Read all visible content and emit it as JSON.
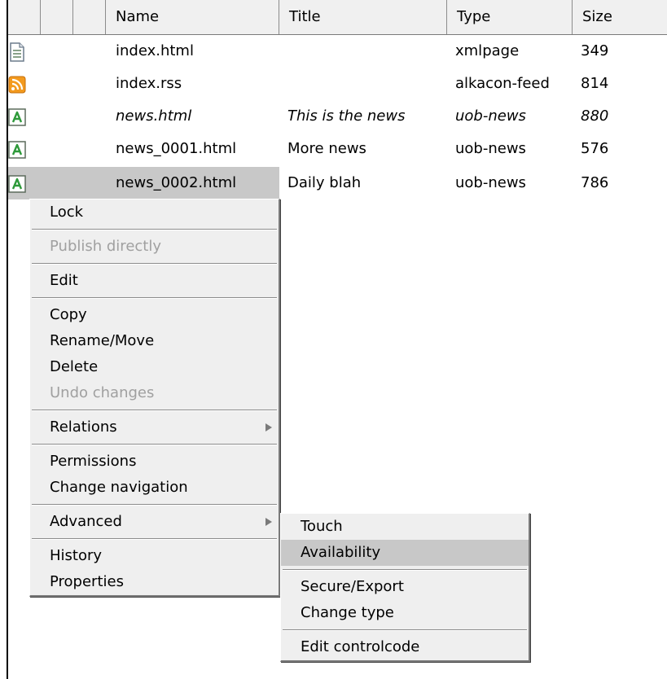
{
  "table": {
    "headers": [
      "Name",
      "Title",
      "Type",
      "Size"
    ],
    "rows": [
      {
        "icon": "xml-page-icon",
        "name": "index.html",
        "title": "",
        "type": "xmlpage",
        "size": "349",
        "italic": false
      },
      {
        "icon": "rss-feed-icon",
        "name": "index.rss",
        "title": "",
        "type": "alkacon-feed",
        "size": "814",
        "italic": false
      },
      {
        "icon": "news-file-icon",
        "name": "news.html",
        "title": "This is the news",
        "type": "uob-news",
        "size": "880",
        "italic": true
      },
      {
        "icon": "news-file-icon",
        "name": "news_0001.html",
        "title": "More news",
        "type": "uob-news",
        "size": "576",
        "italic": false
      },
      {
        "icon": "news-file-icon",
        "name": "news_0002.html",
        "title": "Daily blah",
        "type": "uob-news",
        "size": "786",
        "italic": false
      }
    ]
  },
  "context_menu": {
    "lock": "Lock",
    "publish_directly": "Publish directly",
    "edit": "Edit",
    "copy": "Copy",
    "rename_move": "Rename/Move",
    "delete": "Delete",
    "undo_changes": "Undo changes",
    "relations": "Relations",
    "permissions": "Permissions",
    "change_navigation": "Change navigation",
    "advanced": "Advanced",
    "history": "History",
    "properties": "Properties"
  },
  "submenu": {
    "touch": "Touch",
    "availability": "Availability",
    "secure_export": "Secure/Export",
    "change_type": "Change type",
    "edit_controlcode": "Edit controlcode"
  },
  "colors": {
    "header_bg": "#f0f0f0",
    "menu_bg": "#efefef",
    "highlight": "#c8c8c8",
    "disabled_text": "#a0a0a0",
    "rss_orange": "#f39a1e",
    "news_green": "#2e9a3a"
  }
}
